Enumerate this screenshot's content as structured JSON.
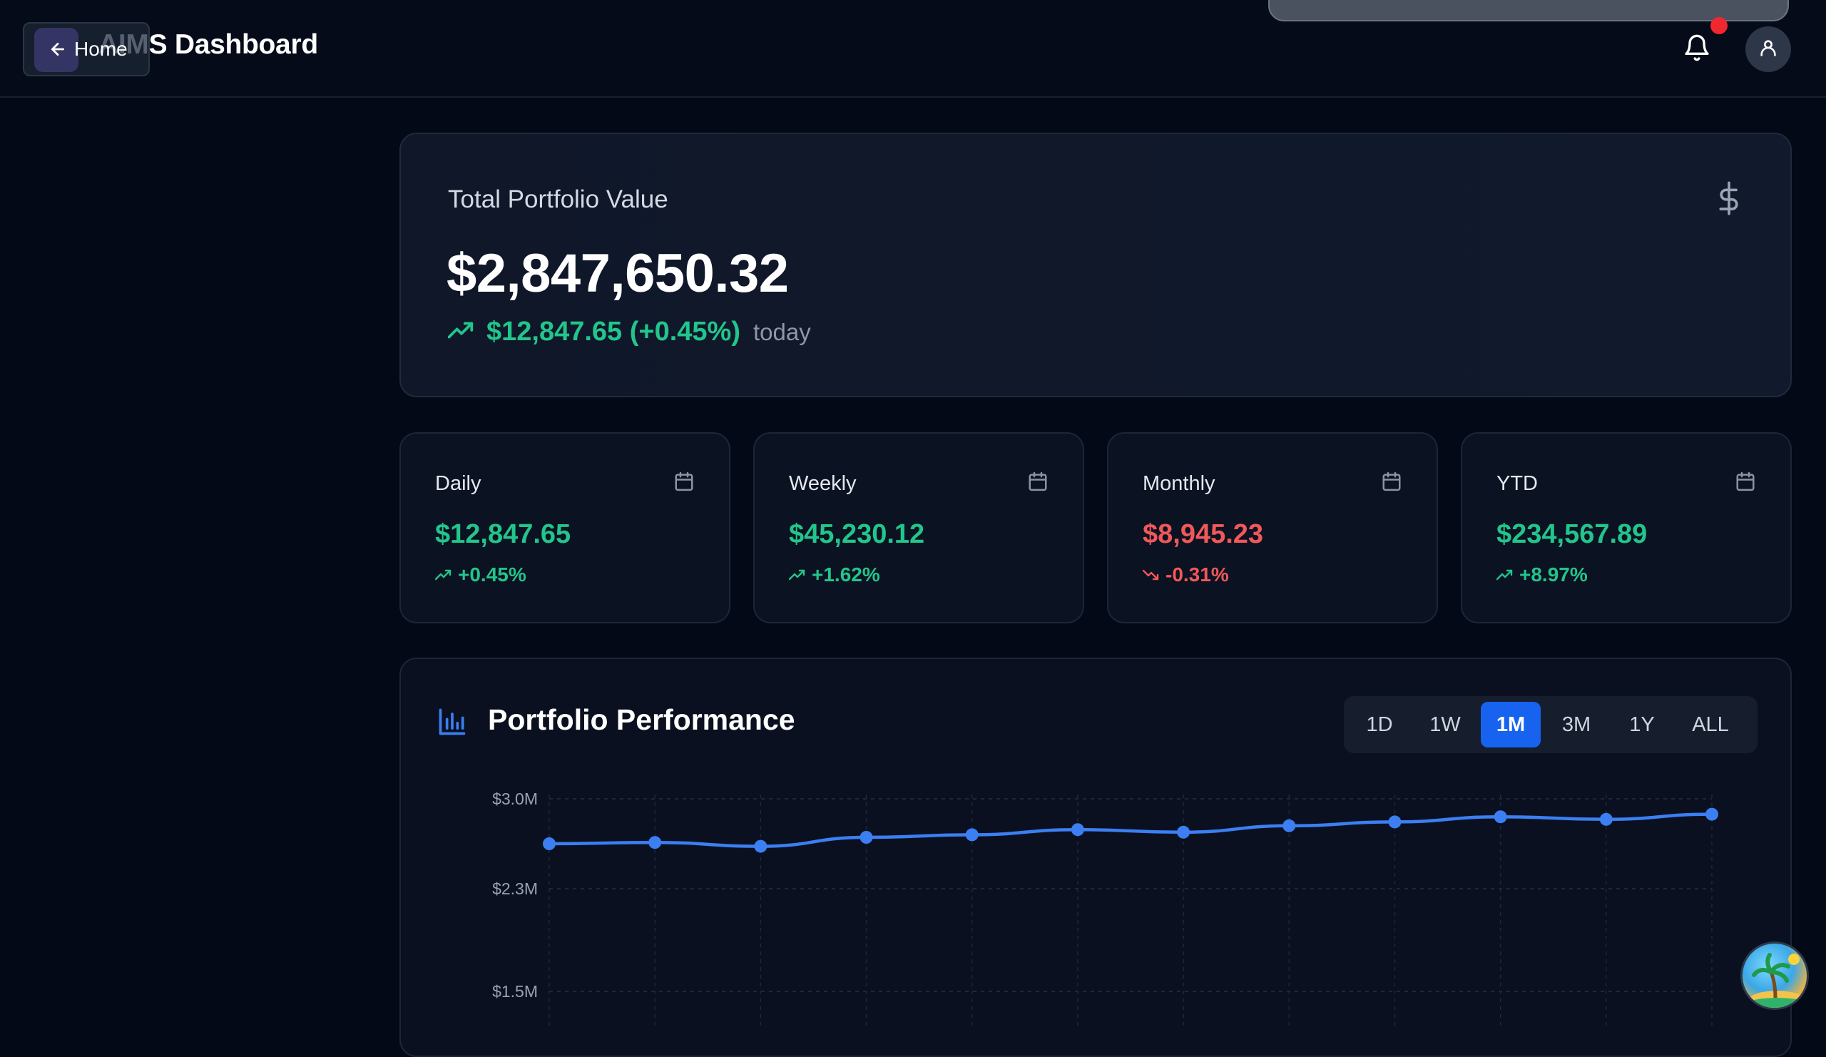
{
  "header": {
    "home_label": "Home",
    "title_faded": "AIM",
    "title_main": "S Dashboard"
  },
  "portfolio": {
    "label": "Total Portfolio Value",
    "value": "$2,847,650.32",
    "change": "$12,847.65 (+0.45%)",
    "period": "today"
  },
  "stats": [
    {
      "label": "Daily",
      "value": "$12,847.65",
      "change": "+0.45%",
      "trend": "up"
    },
    {
      "label": "Weekly",
      "value": "$45,230.12",
      "change": "+1.62%",
      "trend": "up"
    },
    {
      "label": "Monthly",
      "value": "$8,945.23",
      "change": "-0.31%",
      "trend": "down"
    },
    {
      "label": "YTD",
      "value": "$234,567.89",
      "change": "+8.97%",
      "trend": "up"
    }
  ],
  "performance": {
    "title": "Portfolio Performance",
    "ranges": [
      "1D",
      "1W",
      "1M",
      "3M",
      "1Y",
      "ALL"
    ],
    "active_range": "1M"
  },
  "colors": {
    "accent": "#1763f0",
    "line": "#3b7ff2",
    "positive": "#22c58b",
    "negative": "#f0585a"
  },
  "icons": {
    "back": "arrow-left-icon",
    "bell": "bell-icon",
    "user": "user-icon",
    "dollar": "dollar-icon",
    "calendar": "calendar-icon",
    "trend_up": "trending-up-icon",
    "trend_down": "trending-down-icon",
    "chart": "bar-chart-icon"
  },
  "chart_data": {
    "type": "line",
    "title": "Portfolio Performance",
    "y_tick_labels": [
      "$3.0M",
      "$2.3M",
      "$1.5M"
    ],
    "y_ticks": [
      3.0,
      2.3,
      1.5
    ],
    "ylim_visible": [
      1.5,
      3.0
    ],
    "x": [
      1,
      2,
      3,
      4,
      5,
      6,
      7,
      8,
      9,
      10,
      11,
      12
    ],
    "series": [
      {
        "values": [
          2.65,
          2.66,
          2.63,
          2.7,
          2.72,
          2.76,
          2.74,
          2.79,
          2.82,
          2.86,
          2.84,
          2.88
        ]
      }
    ],
    "grid": true
  }
}
